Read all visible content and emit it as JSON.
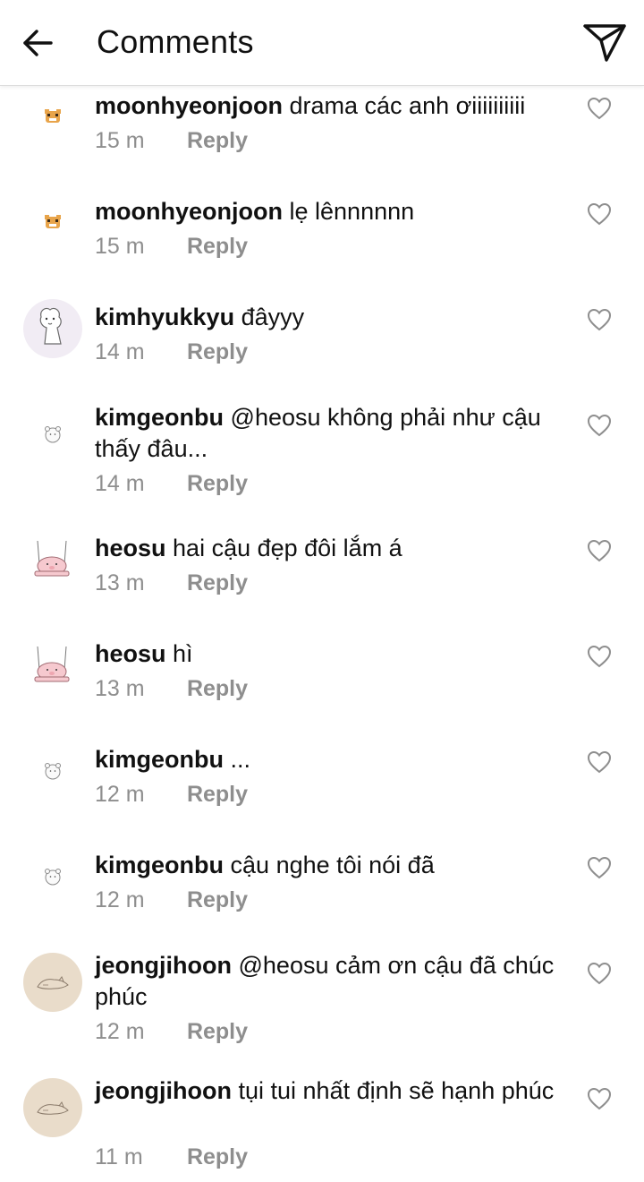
{
  "header": {
    "title": "Comments"
  },
  "comments": [
    {
      "username": "moonhyeonjoon",
      "text": "drama các anh ơiiiiiiiiii",
      "time": "15 m",
      "reply": "Reply",
      "avatar": "tiger-sticker"
    },
    {
      "username": "moonhyeonjoon",
      "text": "lẹ lênnnnnn",
      "time": "15 m",
      "reply": "Reply",
      "avatar": "tiger-sticker"
    },
    {
      "username": "kimhyukkyu",
      "text": "đâyyy",
      "time": "14 m",
      "reply": "Reply",
      "avatar": "alpaca-drawing"
    },
    {
      "username": "kimgeonbu",
      "text": "@heosu không phải như cậu thấy đâu...",
      "time": "14 m",
      "reply": "Reply",
      "avatar": "bear-sketch"
    },
    {
      "username": "heosu",
      "text": "hai cậu đẹp đôi lắm á",
      "time": "13 m",
      "reply": "Reply",
      "avatar": "pig-swing"
    },
    {
      "username": "heosu",
      "text": "hì",
      "time": "13 m",
      "reply": "Reply",
      "avatar": "pig-swing"
    },
    {
      "username": "kimgeonbu",
      "text": "...",
      "time": "12 m",
      "reply": "Reply",
      "avatar": "bear-sketch"
    },
    {
      "username": "kimgeonbu",
      "text": "cậu nghe tôi nói đã",
      "time": "12 m",
      "reply": "Reply",
      "avatar": "bear-sketch"
    },
    {
      "username": "jeongjihoon",
      "text": "@heosu cảm ơn cậu đã chúc phúc",
      "time": "12 m",
      "reply": "Reply",
      "avatar": "cat-sketch"
    },
    {
      "username": "jeongjihoon",
      "text": "tụi tui nhất định sẽ hạnh phúc",
      "time": "11 m",
      "reply": "Reply",
      "avatar": "cat-sketch"
    }
  ],
  "colors": {
    "meta": "#8e8e8e",
    "text": "#111111",
    "divider": "#dcdcdc",
    "heart": "#8e8e8e"
  }
}
